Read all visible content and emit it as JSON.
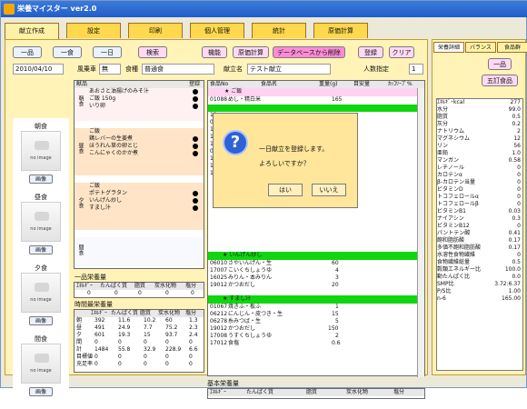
{
  "window": {
    "title": "栄養マイスター ver2.0"
  },
  "tabs": [
    "献立作成",
    "設定",
    "印刷",
    "個人管理",
    "統計",
    "原価計算"
  ],
  "toolbar": {
    "one_dish": "一品",
    "one_meal": "一食",
    "one_day": "一日",
    "search": "検索",
    "function": "機能",
    "cost_calc": "原価計算",
    "delete_db": "データベースから削除",
    "register": "登録",
    "clear": "クリア"
  },
  "form": {
    "date": "2010/04/10",
    "weekday_label": "風乗車",
    "weekday_value": "無",
    "meal_type_label": "食種",
    "meal_type_value": "普通食",
    "menu_name_label": "献立名",
    "menu_name_value": "テスト献立",
    "people_label": "人数指定",
    "people_value": "1"
  },
  "sidebar": {
    "breakfast": "朝食",
    "lunch": "昼食",
    "dinner": "夕食",
    "snack": "間食",
    "no_image": "no image",
    "image_button": "画像"
  },
  "menu_list": {
    "headers": [
      "献品",
      "",
      "",
      "登録"
    ],
    "sections": [
      {
        "label": "朝食",
        "items": [
          "あおさと油揚げのみそ汁",
          "ご飯 150g",
          "いり卵"
        ]
      },
      {
        "label": "昼食",
        "items": [
          "ご飯",
          "鶏レバーの生姜煮",
          "ほうれん草の卵とじ",
          "こんにゃくのかか煮"
        ]
      },
      {
        "label": "夕食",
        "items": [
          "ご飯",
          "ポテトグラタン",
          "いんげん炒し",
          "すまし汁"
        ]
      },
      {
        "label": "間食",
        "items": []
      }
    ]
  },
  "single_item": {
    "title": "一品栄養量",
    "headers": [
      "ｴﾈﾙｷﾞｰ",
      "たんぱく質",
      "脂質",
      "炭水化物",
      "塩分"
    ],
    "values": [
      "0",
      "0",
      "0",
      "0",
      "0"
    ]
  },
  "time_nutrition": {
    "title": "時間最栄養量",
    "headers": [
      "ｴﾈﾙｷﾞｰ",
      "たんぱく質",
      "脂質",
      "炭水化物",
      "塩分"
    ],
    "rows": [
      {
        "label": "朝",
        "values": [
          "392",
          "11.6",
          "10.2",
          "60",
          "1.3"
        ]
      },
      {
        "label": "昼",
        "values": [
          "491",
          "24.9",
          "7.7",
          "75.2",
          "2.3"
        ]
      },
      {
        "label": "夕",
        "values": [
          "601",
          "19.3",
          "15",
          "93.7",
          "2.4"
        ]
      },
      {
        "label": "間",
        "values": [
          "0",
          "0",
          "0",
          "0",
          "0"
        ]
      },
      {
        "label": "計",
        "values": [
          "1484",
          "55.8",
          "32.9",
          "228.9",
          "6.6"
        ]
      },
      {
        "label": "目標値",
        "values": [
          "0",
          "0",
          "0",
          "0",
          "0"
        ]
      },
      {
        "label": "充足率",
        "values": [
          "0",
          "0",
          "0",
          "0",
          "0"
        ]
      }
    ]
  },
  "ingredients": {
    "headers": [
      "食品No",
      "食品名",
      "重量(g)",
      "目安量",
      "ｶｯｺﾘｰﾌﾟ%"
    ],
    "groups": [
      {
        "title": "★ ご飯",
        "rows": [
          {
            "no": "01088",
            "name": "めし・精白米",
            "weight": "165"
          }
        ]
      },
      {
        "title": "",
        "rows": [
          {
            "no": "11",
            "name": "",
            "weight": ""
          },
          {
            "no": "02",
            "name": "",
            "weight": ""
          },
          {
            "no": "14",
            "name": "",
            "weight": ""
          },
          {
            "no": "17",
            "name": "",
            "weight": ""
          },
          {
            "no": "17",
            "name": "",
            "weight": ""
          },
          {
            "no": "03",
            "name": "",
            "weight": ""
          },
          {
            "no": "17",
            "name": "",
            "weight": ""
          },
          {
            "no": "16",
            "name": "",
            "weight": ""
          },
          {
            "no": "11",
            "name": "",
            "weight": ""
          }
        ]
      },
      {
        "title": "★ いんげん炒し",
        "rows": [
          {
            "no": "06010",
            "name": "さやいんげん・生",
            "weight": "60"
          },
          {
            "no": "17007",
            "name": "こいくちしょうゆ",
            "weight": "4"
          },
          {
            "no": "16025",
            "name": "みりん・本みりん",
            "weight": "3"
          },
          {
            "no": "19012",
            "name": "かつおだし",
            "weight": "20"
          }
        ]
      },
      {
        "title": "★ すまし汁",
        "rows": [
          {
            "no": "01067",
            "name": "焼きふ・板ふ",
            "weight": "1"
          },
          {
            "no": "06212",
            "name": "にんじん・皮つき・生",
            "weight": "15"
          },
          {
            "no": "06278",
            "name": "糸みつば・生",
            "weight": "5"
          },
          {
            "no": "19012",
            "name": "かつおだし",
            "weight": "150"
          },
          {
            "no": "17008",
            "name": "うすくちしょうゆ",
            "weight": "2"
          },
          {
            "no": "17012",
            "name": "食塩",
            "weight": "0.6"
          }
        ]
      }
    ]
  },
  "basic_nutrition": {
    "title": "基本栄養量",
    "headers": [
      "ｴﾈﾙｷﾞｰ",
      "たんぱく質",
      "脂質",
      "炭水化物",
      "塩分"
    ],
    "values": [
      "0",
      "0",
      "0",
      "0",
      "0"
    ]
  },
  "dialog": {
    "message1": "一日献立を登録します。",
    "message2": "よろしいですか？",
    "yes": "はい",
    "no": "いいえ"
  },
  "right_panel": {
    "tabs": [
      "栄養詳細",
      "バランス",
      "食品群"
    ],
    "button_one": "一品",
    "button_five": "五訂食品",
    "nutrients": [
      {
        "name": "ｴﾈﾙｷﾞｰkcal",
        "value": "277"
      },
      {
        "name": "水分",
        "value": "99.0"
      },
      {
        "name": "脂質",
        "value": "0.5"
      },
      {
        "name": "灰分",
        "value": "0.2"
      },
      {
        "name": "ナトリウム",
        "value": "2"
      },
      {
        "name": "マグネシウム",
        "value": "12"
      },
      {
        "name": "リン",
        "value": "56"
      },
      {
        "name": "亜鉛",
        "value": "1.0"
      },
      {
        "name": "マンガン",
        "value": "0.58"
      },
      {
        "name": "レチノール",
        "value": "0"
      },
      {
        "name": "カロテンα",
        "value": "0"
      },
      {
        "name": "β-カロテン当量",
        "value": "0"
      },
      {
        "name": "ビタミンD",
        "value": "0"
      },
      {
        "name": "トコフェロールα",
        "value": "0"
      },
      {
        "name": "トコフェロールβ",
        "value": "0"
      },
      {
        "name": "ビタミンB1",
        "value": "0.03"
      },
      {
        "name": "ナイアシン",
        "value": "0.3"
      },
      {
        "name": "ビタミンB12",
        "value": "0"
      },
      {
        "name": "パントテン酸",
        "value": "0.41"
      },
      {
        "name": "飽和脂肪酸",
        "value": "0.17"
      },
      {
        "name": "多価不飽和脂肪酸",
        "value": "0.17"
      },
      {
        "name": "水溶性食物繊維",
        "value": "0"
      },
      {
        "name": "食物繊維総量",
        "value": "0.5"
      },
      {
        "name": "穀類エネルギー比",
        "value": "100.0"
      },
      {
        "name": "動たんぱく比",
        "value": "0.0"
      },
      {
        "name": "SMP比",
        "value": "3.72:6.37"
      },
      {
        "name": "P/S比",
        "value": "1.00"
      },
      {
        "name": "n-6",
        "value": "165.00"
      }
    ]
  }
}
